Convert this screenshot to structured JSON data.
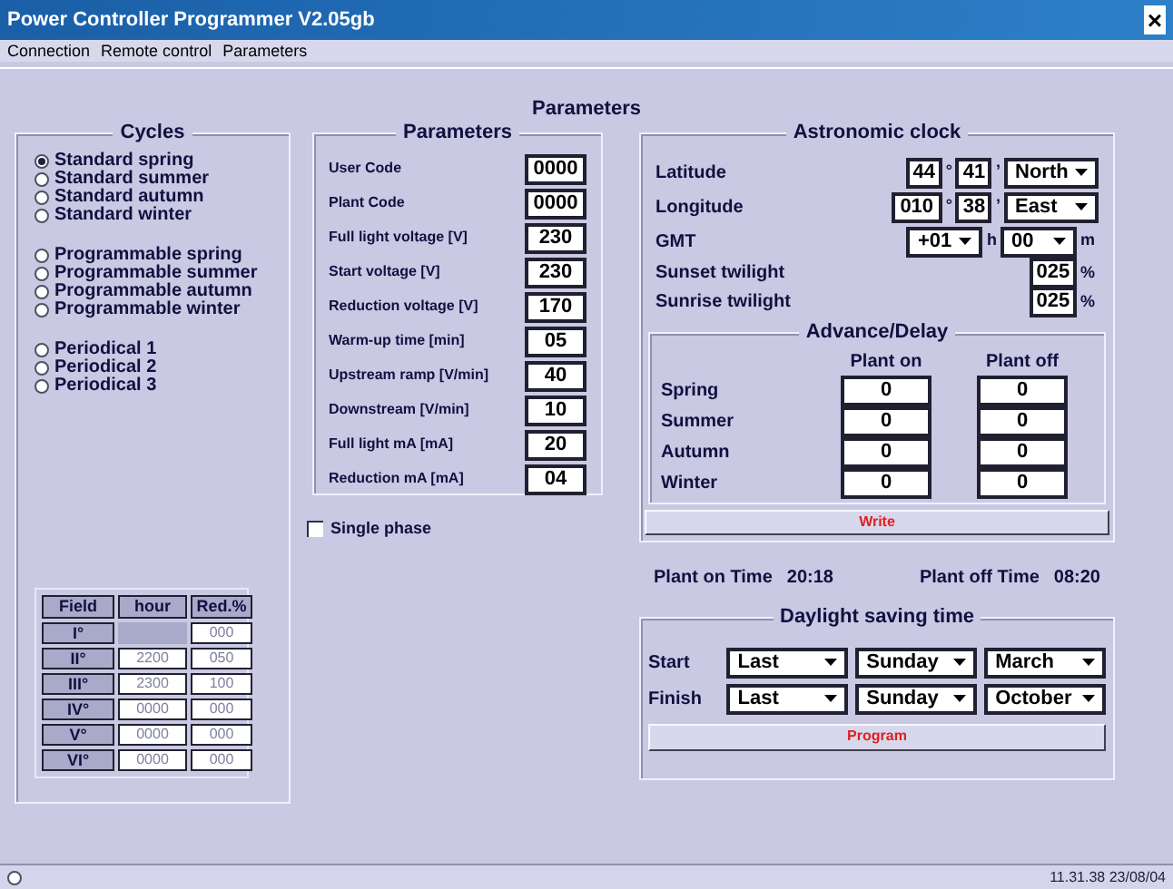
{
  "window": {
    "title": "Power Controller Programmer V2.05gb",
    "close": "×"
  },
  "menu": [
    "Connection",
    "Remote control",
    "Parameters"
  ],
  "heading": "Parameters",
  "cycles": {
    "title": "Cycles",
    "groups": [
      [
        {
          "label": "Standard spring",
          "selected": true
        },
        {
          "label": "Standard summer",
          "selected": false
        },
        {
          "label": "Standard autumn",
          "selected": false
        },
        {
          "label": "Standard winter",
          "selected": false
        }
      ],
      [
        {
          "label": "Programmable spring",
          "selected": false
        },
        {
          "label": "Programmable summer",
          "selected": false
        },
        {
          "label": "Programmable autumn",
          "selected": false
        },
        {
          "label": "Programmable winter",
          "selected": false
        }
      ],
      [
        {
          "label": "Periodical 1",
          "selected": false
        },
        {
          "label": "Periodical 2",
          "selected": false
        },
        {
          "label": "Periodical 3",
          "selected": false
        }
      ]
    ],
    "table": {
      "columns": [
        "Field",
        "hour",
        "Red.%"
      ],
      "rows": [
        [
          "I°",
          "",
          "000"
        ],
        [
          "II°",
          "2200",
          "050"
        ],
        [
          "III°",
          "2300",
          "100"
        ],
        [
          "IV°",
          "0000",
          "000"
        ],
        [
          "V°",
          "0000",
          "000"
        ],
        [
          "VI°",
          "0000",
          "000"
        ]
      ]
    }
  },
  "parameters": {
    "title": "Parameters",
    "fields": [
      {
        "label": "User Code",
        "value": "0000"
      },
      {
        "label": "Plant Code",
        "value": "0000"
      },
      {
        "label": "Full light voltage [V]",
        "value": "230"
      },
      {
        "label": "Start voltage [V]",
        "value": "230"
      },
      {
        "label": "Reduction voltage [V]",
        "value": "170"
      },
      {
        "label": "Warm-up time [min]",
        "value": "05"
      },
      {
        "label": "Upstream ramp [V/min]",
        "value": "40"
      },
      {
        "label": "Downstream [V/min]",
        "value": "10"
      },
      {
        "label": "Full light mA [mA]",
        "value": "20"
      },
      {
        "label": "Reduction mA [mA]",
        "value": "04"
      }
    ],
    "single_phase": {
      "label": "Single phase",
      "checked": false
    }
  },
  "astronomic_clock": {
    "title": "Astronomic clock",
    "latitude": {
      "label": "Latitude",
      "deg": "44",
      "deg_sign": "°",
      "min": "41",
      "min_sign": "’",
      "dir": "North"
    },
    "longitude": {
      "label": "Longitude",
      "deg": "010",
      "deg_sign": "°",
      "min": "38",
      "min_sign": "’",
      "dir": "East"
    },
    "gmt": {
      "label": "GMT",
      "hours": "+01",
      "h_unit": "h",
      "minutes": "00",
      "m_unit": "m"
    },
    "twilight": [
      {
        "label": "Sunset twilight",
        "value": "025",
        "unit": "%"
      },
      {
        "label": "Sunrise twilight",
        "value": "025",
        "unit": "%"
      }
    ],
    "advance_delay": {
      "title": "Advance/Delay",
      "columns": [
        "Plant on",
        "Plant off"
      ],
      "rows": [
        {
          "season": "Spring",
          "on": "0",
          "off": "0"
        },
        {
          "season": "Summer",
          "on": "0",
          "off": "0"
        },
        {
          "season": "Autumn",
          "on": "0",
          "off": "0"
        },
        {
          "season": "Winter",
          "on": "0",
          "off": "0"
        }
      ]
    },
    "write_button": "Write"
  },
  "plant_on": {
    "label": "Plant on Time",
    "value": "20:18"
  },
  "plant_off": {
    "label": "Plant off Time",
    "value": "08:20"
  },
  "daylight_saving": {
    "title": "Daylight saving time",
    "rows": [
      {
        "label": "Start",
        "week": "Last",
        "day": "Sunday",
        "month": "March"
      },
      {
        "label": "Finish",
        "week": "Last",
        "day": "Sunday",
        "month": "October"
      }
    ],
    "program_button": "Program"
  },
  "status_bar": {
    "time": "11.31.38 23/08/04"
  }
}
